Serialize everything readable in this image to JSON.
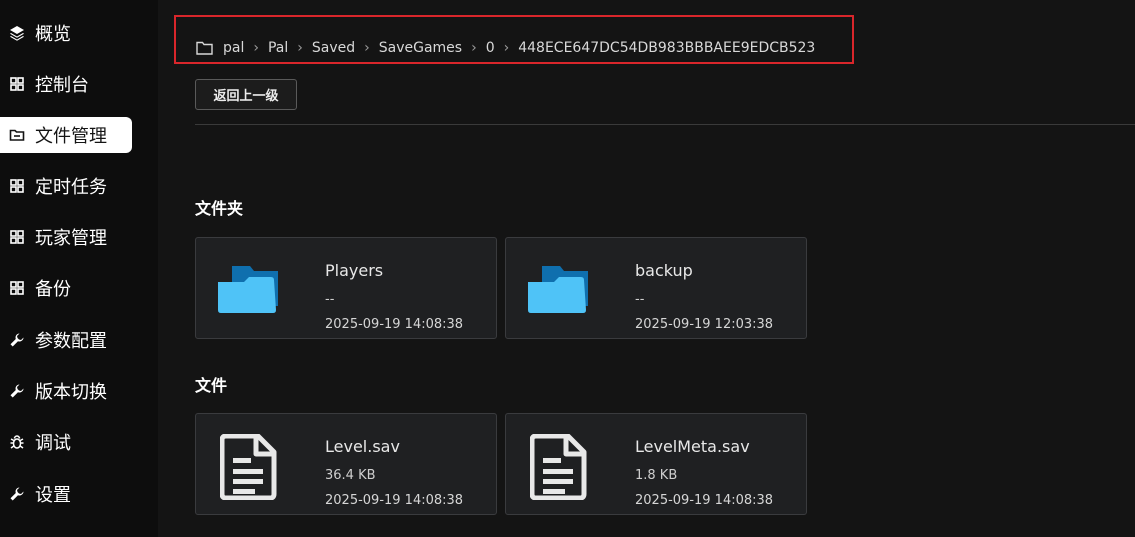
{
  "sidebar": {
    "items": [
      {
        "label": "概览",
        "icon": "layers-icon"
      },
      {
        "label": "控制台",
        "icon": "grid-icon"
      },
      {
        "label": "文件管理",
        "icon": "folder-icon",
        "active": true
      },
      {
        "label": "定时任务",
        "icon": "grid-icon"
      },
      {
        "label": "玩家管理",
        "icon": "grid-icon"
      },
      {
        "label": "备份",
        "icon": "grid-icon"
      },
      {
        "label": "参数配置",
        "icon": "wrench-icon"
      },
      {
        "label": "版本切换",
        "icon": "wrench-icon"
      },
      {
        "label": "调试",
        "icon": "bug-icon"
      },
      {
        "label": "设置",
        "icon": "wrench-icon"
      }
    ]
  },
  "breadcrumb": {
    "items": [
      "pal",
      "Pal",
      "Saved",
      "SaveGames",
      "0",
      "448ECE647DC54DB983BBBAEE9EDCB523"
    ],
    "highlight_color": "#d9262b"
  },
  "toolbar": {
    "back_label": "返回上一级"
  },
  "folders": {
    "title": "文件夹",
    "items": [
      {
        "name": "Players",
        "size": "--",
        "date": "2025-09-19 14:08:38"
      },
      {
        "name": "backup",
        "size": "--",
        "date": "2025-09-19 12:03:38"
      }
    ]
  },
  "files": {
    "title": "文件",
    "items": [
      {
        "name": "Level.sav",
        "size": "36.4 KB",
        "date": "2025-09-19 14:08:38"
      },
      {
        "name": "LevelMeta.sav",
        "size": "1.8 KB",
        "date": "2025-09-19 14:08:38"
      }
    ]
  },
  "colors": {
    "folder_front": "#4fc3f7",
    "folder_back": "#0f6fae",
    "file_icon": "#e8e8e8"
  }
}
